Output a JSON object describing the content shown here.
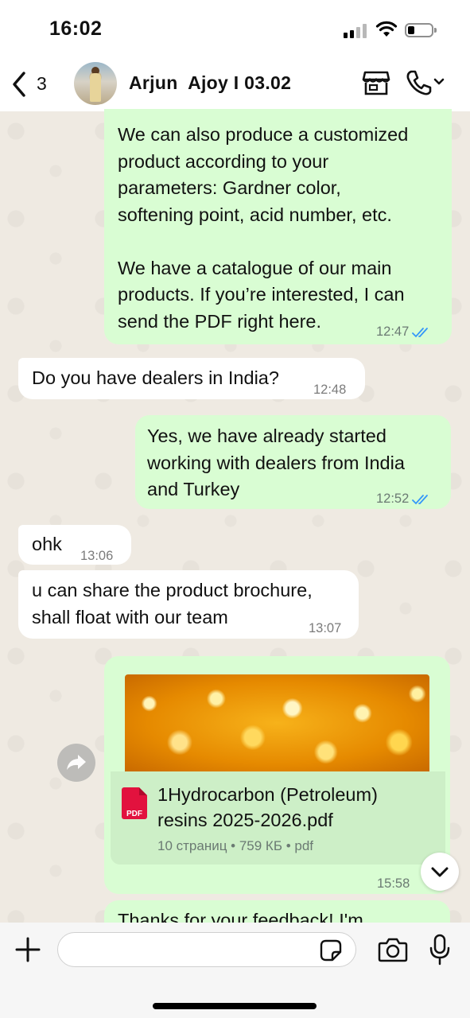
{
  "status_bar": {
    "time": "16:02"
  },
  "header": {
    "back_count": "3",
    "contact_name": "Arjun  Ajoy I 03.02"
  },
  "messages": [
    {
      "direction": "out",
      "text": "We can also produce a customized\nproduct according to your\nparameters: Gardner color,\nsoftening point, acid number, etc.\n\nWe have a catalogue of our main\nproducts. If you’re interested, I can\nsend the PDF right here.",
      "time": "12:47",
      "status": "read"
    },
    {
      "direction": "in",
      "text": "Do you have dealers in India?",
      "time": "12:48"
    },
    {
      "direction": "out",
      "text": "Yes, we have already started\nworking with dealers from India\nand Turkey",
      "time": "12:52",
      "status": "read"
    },
    {
      "direction": "in",
      "text": "ohk",
      "time": "13:06"
    },
    {
      "direction": "in",
      "text": "u can share the product brochure,\nshall float with our team",
      "time": "13:07"
    },
    {
      "direction": "out",
      "type": "document",
      "file_icon_label": "PDF",
      "file_name": "1Hydrocarbon (Petroleum)\nresins 2025-2026.pdf",
      "file_meta": "10 страниц • 759 КБ • pdf",
      "time": "15:58"
    },
    {
      "direction": "out",
      "text": "Thanks for your feedback! I'm",
      "partial": true
    }
  ],
  "composer": {
    "value": "",
    "placeholder": ""
  },
  "colors": {
    "outgoing_bubble": "#d9fdd3",
    "incoming_bubble": "#ffffff",
    "read_tick": "#3497f9",
    "pdf_red": "#e2123e"
  },
  "icons": [
    "back-chevron-icon",
    "store-icon",
    "call-icon",
    "chevron-down-icon",
    "forward-icon",
    "plus-icon",
    "sticker-icon",
    "camera-icon",
    "microphone-icon",
    "pdf-file-icon"
  ]
}
